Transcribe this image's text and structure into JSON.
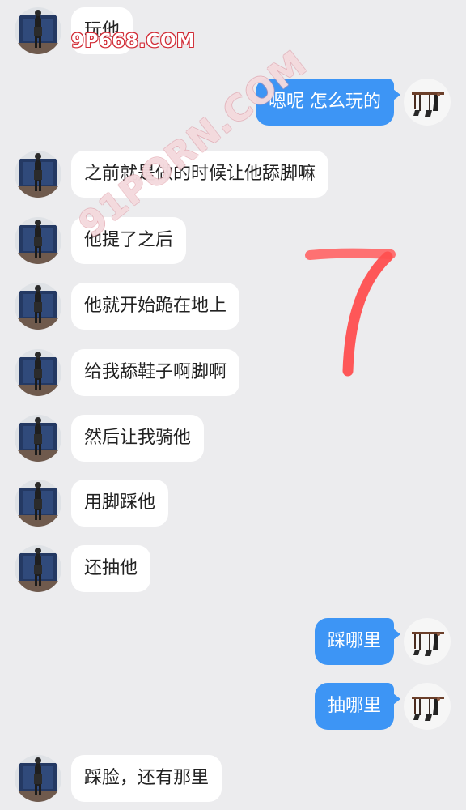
{
  "watermarks": {
    "top": "9P668.COM",
    "diagonal": "91PORN.COM"
  },
  "annotation": {
    "glyph": "7",
    "color": "#ff4f4f"
  },
  "messages": [
    {
      "side": "left",
      "text": "玩他"
    },
    {
      "side": "right",
      "text": "嗯呢 怎么玩的"
    },
    {
      "side": "left",
      "text": "之前就是做的时候让他舔脚嘛"
    },
    {
      "side": "left",
      "text": "他提了之后"
    },
    {
      "side": "left",
      "text": "他就开始跪在地上"
    },
    {
      "side": "left",
      "text": "给我舔鞋子啊脚啊"
    },
    {
      "side": "left",
      "text": "然后让我骑他"
    },
    {
      "side": "left",
      "text": "用脚踩他"
    },
    {
      "side": "left",
      "text": "还抽他"
    },
    {
      "side": "right",
      "text": "踩哪里"
    },
    {
      "side": "right",
      "text": "抽哪里"
    },
    {
      "side": "left",
      "text": "踩脸，还有那里"
    }
  ],
  "colors": {
    "background": "#ececee",
    "incoming_bubble": "#ffffff",
    "outgoing_bubble": "#3d95f5",
    "incoming_text": "#222222",
    "outgoing_text": "#ffffff"
  }
}
